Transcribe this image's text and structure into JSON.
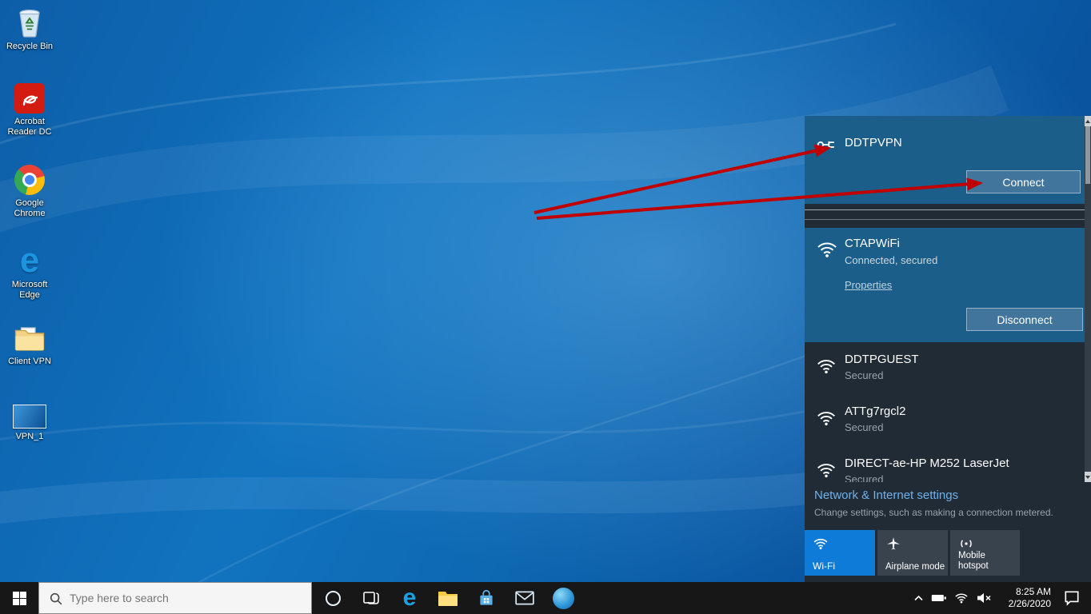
{
  "desktop": {
    "icons": [
      {
        "label": "Recycle Bin"
      },
      {
        "label": "Acrobat Reader DC"
      },
      {
        "label": "Google Chrome"
      },
      {
        "label": "Microsoft Edge"
      },
      {
        "label": "Client VPN"
      },
      {
        "label": "VPN_1"
      }
    ]
  },
  "flyout": {
    "vpn": {
      "name": "DDTPVPN",
      "connect": "Connect"
    },
    "connected": {
      "ssid": "CTAPWiFi",
      "status": "Connected, secured",
      "properties": "Properties",
      "disconnect": "Disconnect"
    },
    "networks": [
      {
        "ssid": "DDTPGUEST",
        "status": "Secured"
      },
      {
        "ssid": "ATTg7rgcl2",
        "status": "Secured"
      },
      {
        "ssid": "DIRECT-ae-HP M252 LaserJet",
        "status": "Secured"
      }
    ],
    "settings_link": "Network & Internet settings",
    "settings_hint": "Change settings, such as making a connection metered.",
    "tiles": {
      "wifi": "Wi-Fi",
      "airplane": "Airplane mode",
      "hotspot": "Mobile hotspot"
    }
  },
  "taskbar": {
    "search_placeholder": "Type here to search",
    "time": "8:25 AM",
    "date": "2/26/2020"
  },
  "colors": {
    "accent": "#0078d7",
    "selected_bg": "#1b5e89",
    "panel_bg": "#212b36",
    "arrow_red": "#c00000"
  }
}
